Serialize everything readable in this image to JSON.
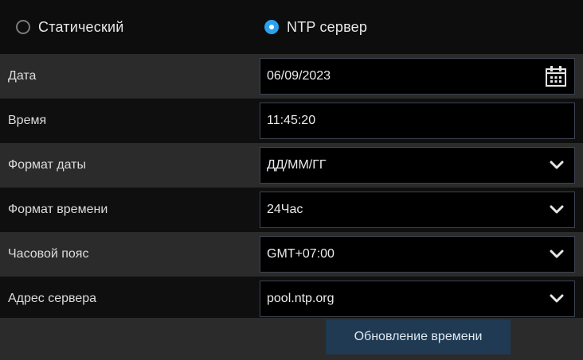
{
  "time_mode": {
    "static_label": "Статический",
    "ntp_label": "NTP сервер",
    "selected": "ntp"
  },
  "rows": [
    {
      "label": "Дата",
      "value": "06/09/2023",
      "control": "date"
    },
    {
      "label": "Время",
      "value": "11:45:20",
      "control": "text"
    },
    {
      "label": "Формат даты",
      "value": "ДД/ММ/ГГ",
      "control": "select"
    },
    {
      "label": "Формат времени",
      "value": "24Час",
      "control": "select"
    },
    {
      "label": "Часовой пояс",
      "value": "GMT+07:00",
      "control": "select"
    },
    {
      "label": "Адрес сервера",
      "value": "pool.ntp.org",
      "control": "select"
    }
  ],
  "buttons": {
    "update_time": "Обновление времени"
  },
  "colors": {
    "accent": "#2aa2f0",
    "panel": "#2b2b2b",
    "row_alt": "#0f0f0f",
    "field_border": "#3d4450",
    "button_bg": "#1f3a52"
  },
  "icons": {
    "date": "calendar-icon",
    "select": "chevron-down-icon"
  }
}
